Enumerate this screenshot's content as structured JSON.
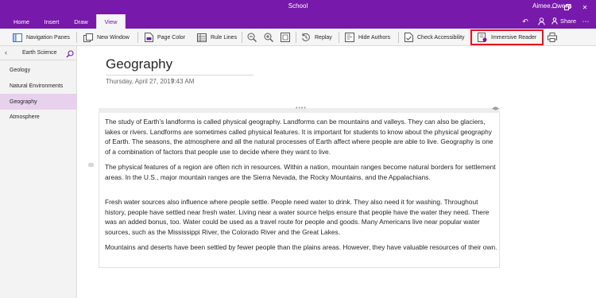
{
  "window": {
    "title": "School",
    "user": "Aimee Owens"
  },
  "tabs": [
    {
      "label": "Home"
    },
    {
      "label": "Insert"
    },
    {
      "label": "Draw"
    },
    {
      "label": "View",
      "active": true
    }
  ],
  "share": {
    "label": "Share"
  },
  "ribbon": {
    "navigation_panes": "Navigation Panes",
    "new_window": "New Window",
    "page_color": "Page Color",
    "rule_lines": "Rule Lines",
    "replay": "Replay",
    "hide_authors": "Hide Authors",
    "check_accessibility": "Check Accessibility",
    "immersive_reader": "Immersive Reader"
  },
  "highlight_color": "#e81123",
  "accent_color": "#7719aa",
  "sidebar": {
    "section_title": "Earth Science",
    "pages": [
      {
        "label": "Geology"
      },
      {
        "label": "Natural Environments"
      },
      {
        "label": "Geography",
        "selected": true
      },
      {
        "label": "Atmosphere"
      }
    ]
  },
  "page": {
    "title": "Geography",
    "date": "Thursday, April 27, 2017",
    "time": "9:43 AM",
    "paragraphs": [
      "The study of Earth’s landforms is called physical geography. Landforms can be mountains and valleys. They can also be glaciers, lakes or rivers. Landforms are sometimes called physical features. It is important for students to know about the physical geography of Earth. The seasons, the atmosphere and all the natural processes of Earth affect where people are able to live. Geography is one of a combination of factors that people use to decide where they want to live.",
      "The physical features of a region are often rich in resources. Within a nation, mountain ranges become natural borders for settlement areas. In the U.S., major mountain ranges are the Sierra Nevada, the Rocky Mountains, and the Appalachians.",
      "Fresh water sources also influence where people settle. People need water to drink. They also need it for washing. Throughout history, people have settled near fresh water. Living near a water source helps ensure that people have the water they need. There was an added bonus, too. Water could be used as a travel route for people and goods. Many Americans live near popular water sources, such as the Mississippi River, the Colorado River and the Great Lakes.",
      "Mountains and deserts have been settled by fewer people than the plains areas. However, they have valuable resources of their own."
    ]
  }
}
